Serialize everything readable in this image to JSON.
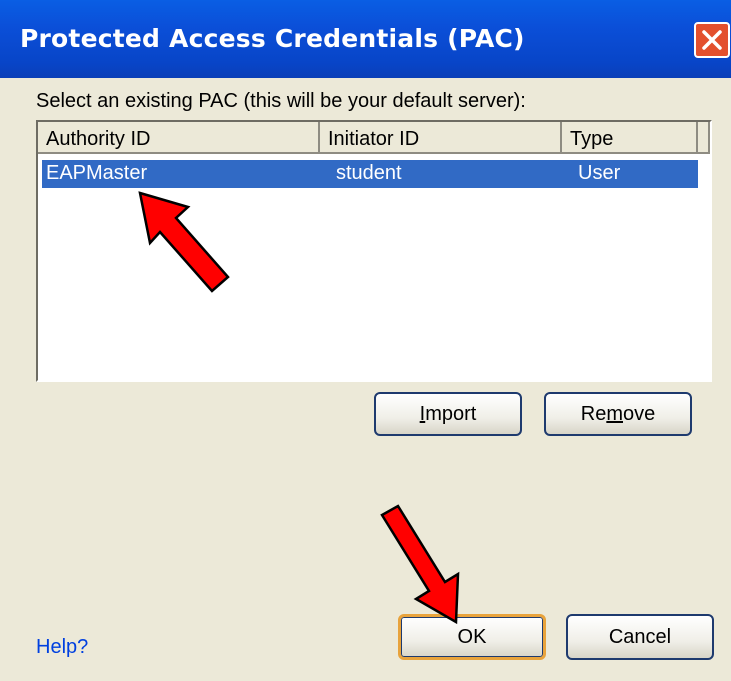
{
  "window": {
    "title": "Protected Access Credentials (PAC)"
  },
  "prompt_text": "Select an existing PAC (this will be your default server):",
  "table": {
    "columns": [
      "Authority ID",
      "Initiator ID",
      "Type"
    ],
    "rows": [
      {
        "authority_id": "EAPMaster",
        "initiator_id": "student",
        "type": "User",
        "selected": true
      }
    ]
  },
  "buttons": {
    "import": {
      "pre": "",
      "key": "I",
      "post": "mport"
    },
    "remove": {
      "pre": "Re",
      "key": "m",
      "post": "ove"
    },
    "ok": "OK",
    "cancel": "Cancel"
  },
  "help_link": "Help?",
  "colors": {
    "titlebar": "#0A5EE4",
    "selection": "#316AC5",
    "arrow": "#FF0000",
    "background": "#ECE9D8"
  }
}
